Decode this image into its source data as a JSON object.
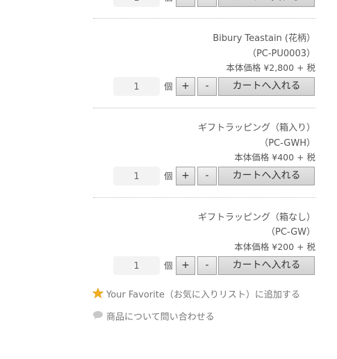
{
  "unit_label": "個",
  "plus_label": "+",
  "minus_label": "-",
  "cart_label": "カートへ入れる",
  "products": [
    {
      "name": "Bibury Teastain (花柄）",
      "code": "（PC-PU0003）",
      "price": "本体価格 ¥2,800 + 税",
      "qty": "1"
    },
    {
      "name": "ギフトラッピング（箱入り）",
      "code": "（PC-GWH）",
      "price": "本体価格 ¥400 + 税",
      "qty": "1"
    },
    {
      "name": "ギフトラッピング（箱なし）",
      "code": "（PC-GW）",
      "price": "本体価格 ¥200 + 税",
      "qty": "1"
    }
  ],
  "favorite_link": "Your Favorite（お気に入りリスト）に追加する",
  "inquiry_link": "商品について問い合わせる",
  "colors": {
    "star": "#f2b01e",
    "bubble": "#c8c8c8",
    "button_border": "#a0a0a0"
  }
}
